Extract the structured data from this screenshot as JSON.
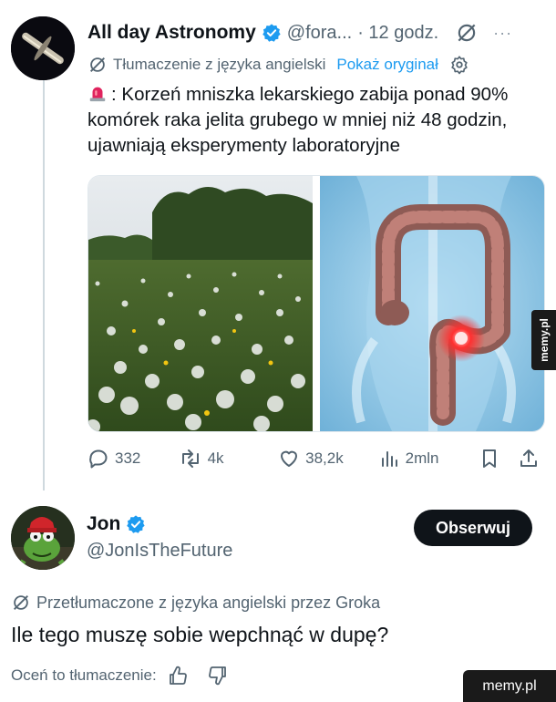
{
  "tweet": {
    "author_name": "All day Astronomy",
    "author_handle": "@fora...",
    "time": "· 12 godz.",
    "translation_label": "Tłumaczenie z języka angielski",
    "show_original": "Pokaż oryginał",
    "text": ": Korzeń mniszka lekarskiego zabija ponad 90% komórek raka jelita grubego w mniej niż 48 godzin, ujawniają eksperymenty laboratoryjne",
    "icons": [
      "verified-badge-icon",
      "grok-icon",
      "more-icon",
      "translate-icon",
      "gear-icon",
      "siren-emoji-icon"
    ],
    "stats": {
      "replies": "332",
      "reposts": "4k",
      "likes": "38,2k",
      "views": "2mln"
    }
  },
  "reply": {
    "author_name": "Jon",
    "author_handle": "@JonIsTheFuture",
    "follow_label": "Obserwuj",
    "translation_label": "Przetłumaczone z języka angielski przez Groka",
    "text": "Ile tego muszę sobie wepchnąć w dupę?",
    "rate_label": "Oceń to tłumaczenie:"
  },
  "watermark": {
    "side": "memy.pl",
    "corner": "memy.pl"
  },
  "colors": {
    "accent": "#1d9bf0",
    "text_secondary": "#536471",
    "follow_bg": "#0f1419"
  }
}
